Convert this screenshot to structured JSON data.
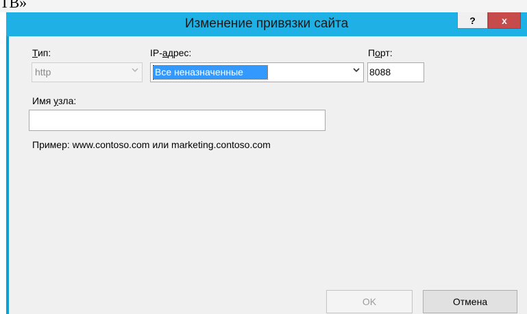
{
  "top_fragment": "ТВ»",
  "window": {
    "title": "Изменение привязки сайта",
    "help_label": "?",
    "close_label": "x"
  },
  "form": {
    "type": {
      "label_u": "Т",
      "label_rest": "ип:",
      "value": "http"
    },
    "ip": {
      "label_prefix": "IP-",
      "label_u": "а",
      "label_rest": "дрес:",
      "value": "Все неназначенные"
    },
    "port": {
      "label_prefix": "П",
      "label_u": "о",
      "label_rest": "рт:",
      "value": "8088"
    },
    "host": {
      "label_prefix": "Имя ",
      "label_u": "у",
      "label_rest": "зла:",
      "value": ""
    },
    "example_text": "Пример: www.contoso.com или marketing.contoso.com"
  },
  "buttons": {
    "ok": "OK",
    "cancel": "Отмена"
  },
  "icons": {
    "dropdown": "chevron-down-icon"
  }
}
